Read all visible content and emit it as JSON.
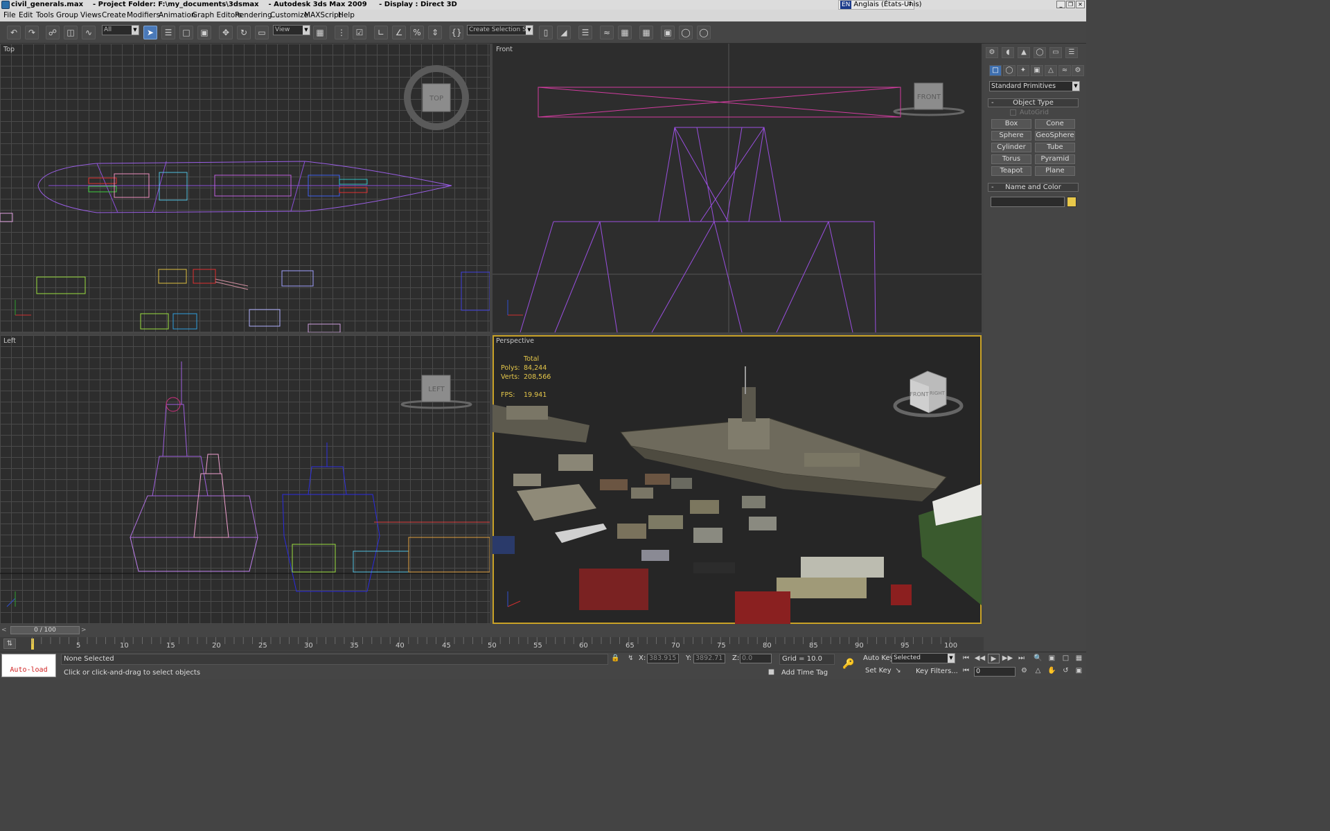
{
  "window": {
    "file": "civil_generals.max",
    "project": "- Project Folder: F:\\my_documents\\3dsmax",
    "app": "- Autodesk 3ds Max  2009",
    "display": "- Display : Direct 3D",
    "lang_code": "EN",
    "lang_name": "Anglais (États-Unis)"
  },
  "menu": [
    "File",
    "Edit",
    "Tools",
    "Group",
    "Views",
    "Create",
    "Modifiers",
    "Animation",
    "Graph Editors",
    "Rendering",
    "Customize",
    "MAXScript",
    "Help"
  ],
  "toolbar": {
    "selection_filter": "All",
    "reference_coord": "View",
    "named_selection": "Create Selection Set"
  },
  "viewports": {
    "top": {
      "label": "Top",
      "cube": "TOP"
    },
    "front": {
      "label": "Front",
      "cube": "FRONT"
    },
    "left": {
      "label": "Left",
      "cube": "LEFT"
    },
    "perspective": {
      "label": "Perspective",
      "stats_header": "Total",
      "polys_label": "Polys:",
      "polys": "84,244",
      "verts_label": "Verts:",
      "verts": "208,566",
      "fps_label": "FPS:",
      "fps": "19.941",
      "cube_front": "FRONT",
      "cube_right": "RIGHT"
    }
  },
  "command_panel": {
    "category": "Standard Primitives",
    "object_type": "Object Type",
    "autogrid": "AutoGrid",
    "buttons": [
      "Box",
      "Cone",
      "Sphere",
      "GeoSphere",
      "Cylinder",
      "Tube",
      "Torus",
      "Pyramid",
      "Teapot",
      "Plane"
    ],
    "name_and_color": "Name and Color",
    "color_swatch": "#e8c84a"
  },
  "timeline": {
    "frame": "0 / 100",
    "ticks": [
      "5",
      "10",
      "15",
      "20",
      "25",
      "30",
      "35",
      "40",
      "45",
      "50",
      "55",
      "60",
      "65",
      "70",
      "75",
      "80",
      "85",
      "90",
      "95",
      "100"
    ]
  },
  "status": {
    "maxscript": "Auto-load",
    "selection": "None Selected",
    "prompt": "Click or click-and-drag to select objects",
    "x_label": "X:",
    "x": "383.915",
    "y_label": "Y:",
    "y": "3892.71",
    "z_label": "Z:",
    "z": "0.0",
    "grid": "Grid = 10.0",
    "add_time_tag": "Add Time Tag",
    "auto_key": "Auto Key",
    "auto_key_mode": "Selected",
    "set_key": "Set Key",
    "key_filters": "Key Filters...",
    "current_frame": "0"
  },
  "colors": {
    "active_viewport": "#c9a227",
    "ship_wire": "#9a5ee6",
    "front_wire": "#9a4fe0",
    "selection_box": "#d23ca0",
    "stats_text": "#e6c84a"
  }
}
